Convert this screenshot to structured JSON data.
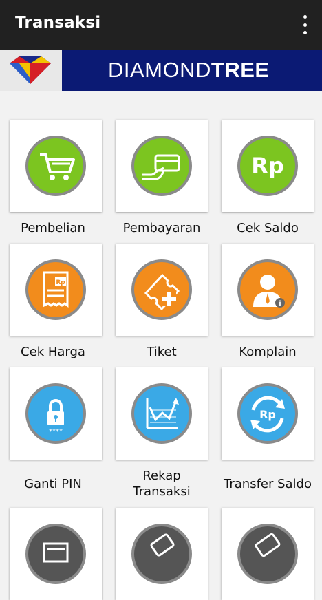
{
  "appbar": {
    "title": "Transaksi",
    "menu_icon": "more-vert-icon"
  },
  "banner": {
    "brand_light": "DIAMOND",
    "brand_bold": "TREE"
  },
  "menu": {
    "pembelian": {
      "label": "Pembelian",
      "icon": "shopping-cart-icon"
    },
    "pembayaran": {
      "label": "Pembayaran",
      "icon": "card-payment-icon"
    },
    "cek_saldo": {
      "label": "Cek Saldo",
      "icon": "rupiah-icon",
      "icon_text": "Rp"
    },
    "cek_harga": {
      "label": "Cek Harga",
      "icon": "price-receipt-icon",
      "icon_text": "Rp"
    },
    "tiket": {
      "label": "Tiket",
      "icon": "ticket-icon"
    },
    "komplain": {
      "label": "Komplain",
      "icon": "customer-service-icon",
      "icon_text": "i"
    },
    "ganti_pin": {
      "label": "Ganti PIN",
      "icon": "lock-icon",
      "icon_text": "****"
    },
    "rekap_line1": "Rekap",
    "rekap_line2": "Transaksi",
    "rekap": {
      "icon": "chart-icon"
    },
    "transfer_saldo": {
      "label": "Transfer Saldo",
      "icon": "transfer-icon",
      "icon_text": "Rp"
    }
  },
  "colors": {
    "green": "#7cc520",
    "orange": "#f28c1c",
    "blue": "#3aa9e6",
    "gray": "#555555",
    "navy": "#0b1a74"
  }
}
